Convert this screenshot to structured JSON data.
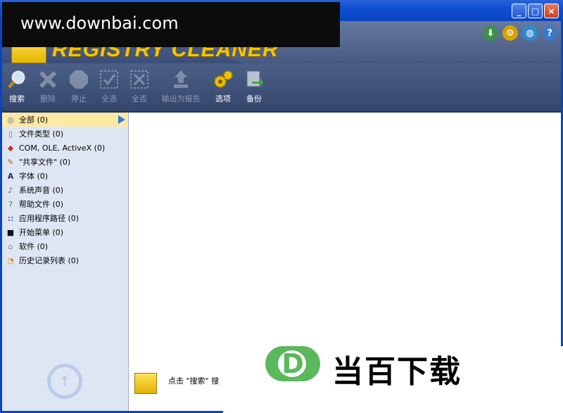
{
  "watermark": {
    "text": "www.downbai.com"
  },
  "app": {
    "brand_text": "REGISTRY CLEANER"
  },
  "window_buttons": {
    "minimize": "_",
    "maximize": "□",
    "close": "×"
  },
  "header_icons": [
    {
      "name": "download-icon",
      "glyph": "⬇",
      "color": "#3e8f4a"
    },
    {
      "name": "gears-icon",
      "glyph": "⚙",
      "color": "#d6a400"
    },
    {
      "name": "globe-icon",
      "glyph": "◍",
      "color": "#2e8bd0"
    },
    {
      "name": "help-icon",
      "glyph": "?",
      "color": "#3a78c9"
    }
  ],
  "toolbar": {
    "search": "搜索",
    "delete": "删除",
    "stop": "停止",
    "select_all": "全选",
    "select_none": "全否",
    "export_report": "输出为报告",
    "options": "选项",
    "backup": "备份"
  },
  "sidebar": {
    "items": [
      {
        "label": "全部 (0)",
        "icon": "◎"
      },
      {
        "label": "文件类型 (0)",
        "icon": "▯"
      },
      {
        "label": "COM, OLE, ActiveX (0)",
        "icon": "◆"
      },
      {
        "label": "\"共享文件\" (0)",
        "icon": "✎"
      },
      {
        "label": "字体 (0)",
        "icon": "A"
      },
      {
        "label": "系统声音 (0)",
        "icon": "♪"
      },
      {
        "label": "帮助文件 (0)",
        "icon": "?"
      },
      {
        "label": "应用程序路径 (0)",
        "icon": "::"
      },
      {
        "label": "开始菜单 (0)",
        "icon": "■"
      },
      {
        "label": "软件 (0)",
        "icon": "⌂"
      },
      {
        "label": "历史记录列表 (0)",
        "icon": "◔"
      }
    ]
  },
  "main": {
    "hint": "点击 \"搜索\" 搜"
  },
  "brand_overlay": {
    "logo_letter": "D",
    "text": "当百下载"
  }
}
